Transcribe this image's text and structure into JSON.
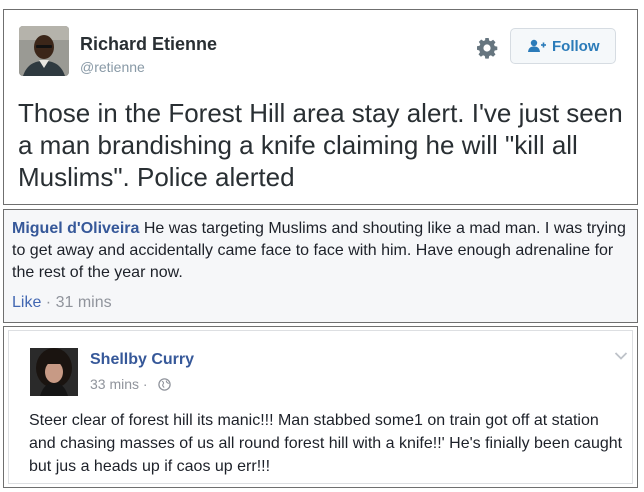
{
  "tweet": {
    "author_name": "Richard Etienne",
    "author_handle": "@retienne",
    "follow_label": "Follow",
    "text": "Those in the Forest Hill area stay alert. I've just seen a man brandishing a knife claiming he will \"kill all Muslims\". Police alerted",
    "icons": {
      "settings": "gear-icon",
      "follow": "add-user-icon"
    }
  },
  "fb_comment": {
    "author_name": "Miguel d'Oliveira",
    "text": "He was targeting Muslims and shouting like a mad man. I was trying to get away and accidentally came face to face with him. Have enough adrenaline for the rest of the year now.",
    "like_label": "Like",
    "separator": " · ",
    "time": "31 mins"
  },
  "fb_post": {
    "author_name": "Shellby Curry",
    "time": "33 mins",
    "separator": " · ",
    "text": "Steer clear of forest hill its manic!!! Man stabbed some1 on train got off at station and chasing masses of us all round forest hill with a knife!!' He's finially been caught but jus a heads up if caos up err!!!",
    "icons": {
      "audience": "globe-icon",
      "menu": "chevron-down-icon"
    }
  },
  "colors": {
    "twitter_text": "#292f33",
    "twitter_blue": "#2b7bb9",
    "facebook_link": "#365899",
    "facebook_meta": "#90949c"
  }
}
